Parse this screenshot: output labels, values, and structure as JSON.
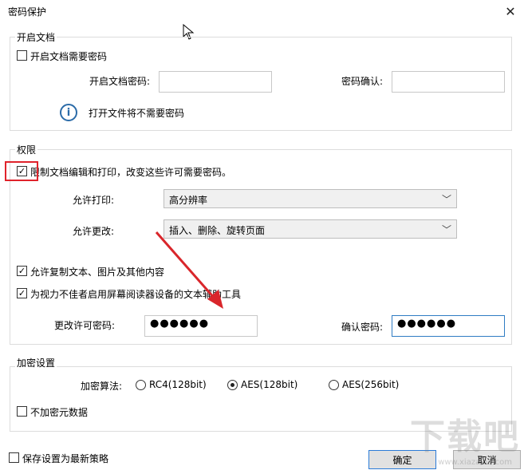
{
  "window": {
    "title": "密码保护",
    "close_symbol": "✕"
  },
  "open_doc": {
    "legend": "开启文档",
    "require_label": "开启文档需要密码",
    "password_label": "开启文档密码:",
    "confirm_label": "密码确认:",
    "info_text": "打开文件将不需要密码",
    "require_checked": false
  },
  "permissions": {
    "legend": "权限",
    "restrict_label": "限制文档编辑和打印，改变这些许可需要密码。",
    "restrict_checked": true,
    "print_label": "允许打印:",
    "print_value": "高分辨率",
    "change_label": "允许更改:",
    "change_value": "插入、删除、旋转页面",
    "copy_label": "允许复制文本、图片及其他内容",
    "copy_checked": true,
    "reader_label": "为视力不佳者启用屏幕阅读器设备的文本辅助工具",
    "reader_checked": true,
    "change_password_label": "更改许可密码:",
    "change_password_value": "●●●●●●",
    "confirm_password_label": "确认密码:",
    "confirm_password_value": "●●●●●●"
  },
  "encryption": {
    "legend": "加密设置",
    "algorithm_label": "加密算法:",
    "options": [
      "RC4(128bit)",
      "AES(128bit)",
      "AES(256bit)"
    ],
    "selected": "AES(128bit)",
    "no_metadata_label": "不加密元数据",
    "no_metadata_checked": false
  },
  "footer": {
    "save_label": "保存设置为最新策略",
    "save_checked": false,
    "ok_label": "确定",
    "cancel_label": "取消"
  },
  "watermark": {
    "text": "下载吧",
    "sub": "www.xiazaiba.com"
  },
  "colors": {
    "highlight": "#e0232b",
    "arrow": "#d9262b",
    "info": "#2b6ba8"
  }
}
